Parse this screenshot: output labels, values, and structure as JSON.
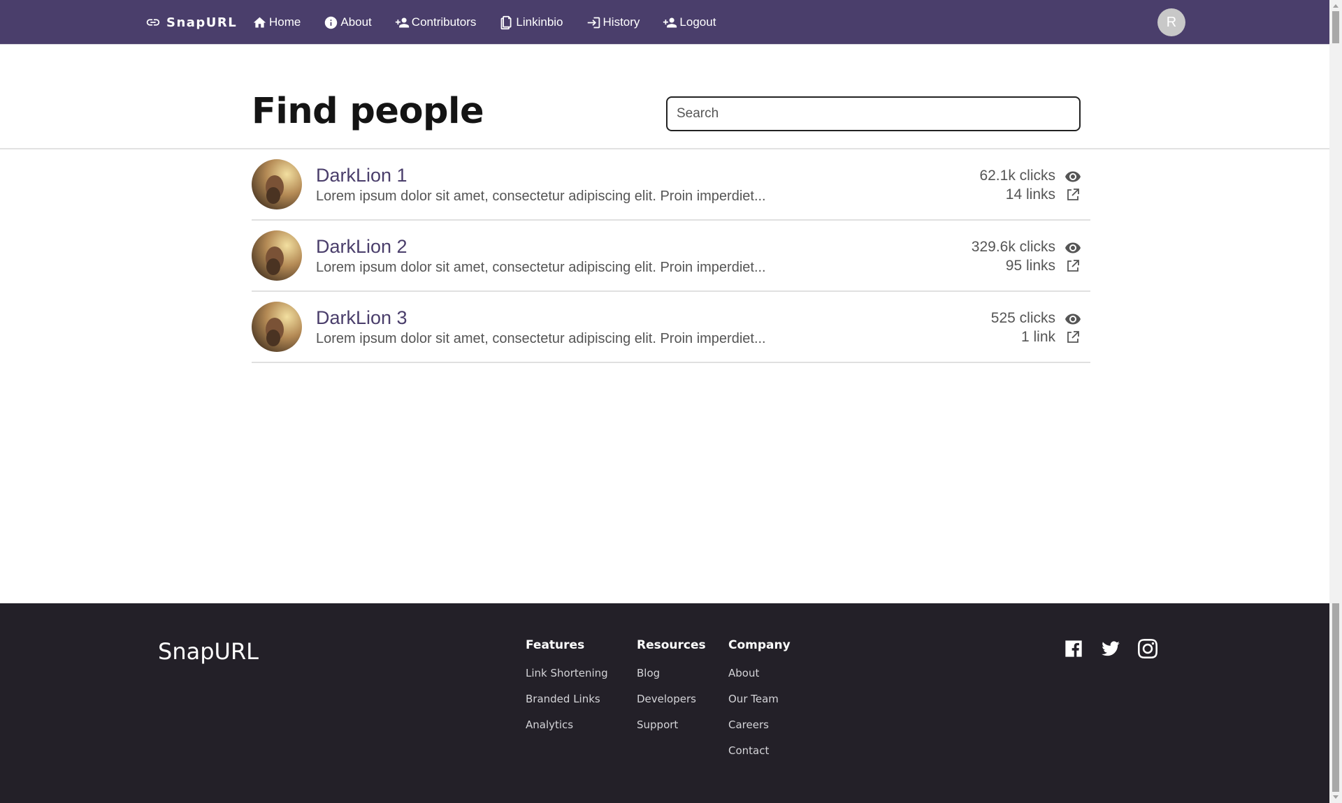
{
  "navbar": {
    "brand": "SnapURL",
    "links": [
      {
        "label": "Home",
        "icon": "home-icon"
      },
      {
        "label": "About",
        "icon": "info-icon"
      },
      {
        "label": "Contributors",
        "icon": "person-add-icon"
      },
      {
        "label": "Linkinbio",
        "icon": "clipboard-icon"
      },
      {
        "label": "History",
        "icon": "login-icon"
      },
      {
        "label": "Logout",
        "icon": "person-add-icon"
      }
    ],
    "avatar_initial": "R"
  },
  "page": {
    "title": "Find people",
    "search_placeholder": "Search"
  },
  "people": [
    {
      "name": "DarkLion 1",
      "description": "Lorem ipsum dolor sit amet, consectetur adipiscing elit. Proin imperdiet...",
      "clicks": "62.1k clicks",
      "links": "14 links"
    },
    {
      "name": "DarkLion 2",
      "description": "Lorem ipsum dolor sit amet, consectetur adipiscing elit. Proin imperdiet...",
      "clicks": "329.6k clicks",
      "links": "95 links"
    },
    {
      "name": "DarkLion 3",
      "description": "Lorem ipsum dolor sit amet, consectetur adipiscing elit. Proin imperdiet...",
      "clicks": "525 clicks",
      "links": "1 link"
    }
  ],
  "footer": {
    "brand": "SnapURL",
    "features": {
      "heading": "Features",
      "items": [
        "Link Shortening",
        "Branded Links",
        "Analytics"
      ]
    },
    "resources": {
      "heading": "Resources",
      "items": [
        "Blog",
        "Developers",
        "Support"
      ]
    },
    "company": {
      "heading": "Company",
      "items": [
        "About",
        "Our Team",
        "Careers",
        "Contact"
      ]
    },
    "social": [
      "facebook-icon",
      "twitter-icon",
      "instagram-icon"
    ]
  },
  "colors": {
    "navbar_bg": "#4a3e6b",
    "accent": "#4a3e6b",
    "footer_bg": "#232028"
  }
}
